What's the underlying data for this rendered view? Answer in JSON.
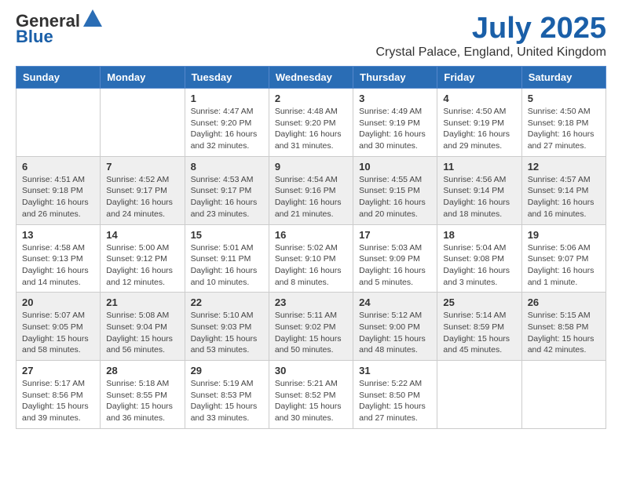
{
  "header": {
    "logo_general": "General",
    "logo_blue": "Blue",
    "month_title": "July 2025",
    "location": "Crystal Palace, England, United Kingdom"
  },
  "weekdays": [
    "Sunday",
    "Monday",
    "Tuesday",
    "Wednesday",
    "Thursday",
    "Friday",
    "Saturday"
  ],
  "weeks": [
    [
      {
        "day": "",
        "info": ""
      },
      {
        "day": "",
        "info": ""
      },
      {
        "day": "1",
        "info": "Sunrise: 4:47 AM\nSunset: 9:20 PM\nDaylight: 16 hours and 32 minutes."
      },
      {
        "day": "2",
        "info": "Sunrise: 4:48 AM\nSunset: 9:20 PM\nDaylight: 16 hours and 31 minutes."
      },
      {
        "day": "3",
        "info": "Sunrise: 4:49 AM\nSunset: 9:19 PM\nDaylight: 16 hours and 30 minutes."
      },
      {
        "day": "4",
        "info": "Sunrise: 4:50 AM\nSunset: 9:19 PM\nDaylight: 16 hours and 29 minutes."
      },
      {
        "day": "5",
        "info": "Sunrise: 4:50 AM\nSunset: 9:18 PM\nDaylight: 16 hours and 27 minutes."
      }
    ],
    [
      {
        "day": "6",
        "info": "Sunrise: 4:51 AM\nSunset: 9:18 PM\nDaylight: 16 hours and 26 minutes."
      },
      {
        "day": "7",
        "info": "Sunrise: 4:52 AM\nSunset: 9:17 PM\nDaylight: 16 hours and 24 minutes."
      },
      {
        "day": "8",
        "info": "Sunrise: 4:53 AM\nSunset: 9:17 PM\nDaylight: 16 hours and 23 minutes."
      },
      {
        "day": "9",
        "info": "Sunrise: 4:54 AM\nSunset: 9:16 PM\nDaylight: 16 hours and 21 minutes."
      },
      {
        "day": "10",
        "info": "Sunrise: 4:55 AM\nSunset: 9:15 PM\nDaylight: 16 hours and 20 minutes."
      },
      {
        "day": "11",
        "info": "Sunrise: 4:56 AM\nSunset: 9:14 PM\nDaylight: 16 hours and 18 minutes."
      },
      {
        "day": "12",
        "info": "Sunrise: 4:57 AM\nSunset: 9:14 PM\nDaylight: 16 hours and 16 minutes."
      }
    ],
    [
      {
        "day": "13",
        "info": "Sunrise: 4:58 AM\nSunset: 9:13 PM\nDaylight: 16 hours and 14 minutes."
      },
      {
        "day": "14",
        "info": "Sunrise: 5:00 AM\nSunset: 9:12 PM\nDaylight: 16 hours and 12 minutes."
      },
      {
        "day": "15",
        "info": "Sunrise: 5:01 AM\nSunset: 9:11 PM\nDaylight: 16 hours and 10 minutes."
      },
      {
        "day": "16",
        "info": "Sunrise: 5:02 AM\nSunset: 9:10 PM\nDaylight: 16 hours and 8 minutes."
      },
      {
        "day": "17",
        "info": "Sunrise: 5:03 AM\nSunset: 9:09 PM\nDaylight: 16 hours and 5 minutes."
      },
      {
        "day": "18",
        "info": "Sunrise: 5:04 AM\nSunset: 9:08 PM\nDaylight: 16 hours and 3 minutes."
      },
      {
        "day": "19",
        "info": "Sunrise: 5:06 AM\nSunset: 9:07 PM\nDaylight: 16 hours and 1 minute."
      }
    ],
    [
      {
        "day": "20",
        "info": "Sunrise: 5:07 AM\nSunset: 9:05 PM\nDaylight: 15 hours and 58 minutes."
      },
      {
        "day": "21",
        "info": "Sunrise: 5:08 AM\nSunset: 9:04 PM\nDaylight: 15 hours and 56 minutes."
      },
      {
        "day": "22",
        "info": "Sunrise: 5:10 AM\nSunset: 9:03 PM\nDaylight: 15 hours and 53 minutes."
      },
      {
        "day": "23",
        "info": "Sunrise: 5:11 AM\nSunset: 9:02 PM\nDaylight: 15 hours and 50 minutes."
      },
      {
        "day": "24",
        "info": "Sunrise: 5:12 AM\nSunset: 9:00 PM\nDaylight: 15 hours and 48 minutes."
      },
      {
        "day": "25",
        "info": "Sunrise: 5:14 AM\nSunset: 8:59 PM\nDaylight: 15 hours and 45 minutes."
      },
      {
        "day": "26",
        "info": "Sunrise: 5:15 AM\nSunset: 8:58 PM\nDaylight: 15 hours and 42 minutes."
      }
    ],
    [
      {
        "day": "27",
        "info": "Sunrise: 5:17 AM\nSunset: 8:56 PM\nDaylight: 15 hours and 39 minutes."
      },
      {
        "day": "28",
        "info": "Sunrise: 5:18 AM\nSunset: 8:55 PM\nDaylight: 15 hours and 36 minutes."
      },
      {
        "day": "29",
        "info": "Sunrise: 5:19 AM\nSunset: 8:53 PM\nDaylight: 15 hours and 33 minutes."
      },
      {
        "day": "30",
        "info": "Sunrise: 5:21 AM\nSunset: 8:52 PM\nDaylight: 15 hours and 30 minutes."
      },
      {
        "day": "31",
        "info": "Sunrise: 5:22 AM\nSunset: 8:50 PM\nDaylight: 15 hours and 27 minutes."
      },
      {
        "day": "",
        "info": ""
      },
      {
        "day": "",
        "info": ""
      }
    ]
  ]
}
